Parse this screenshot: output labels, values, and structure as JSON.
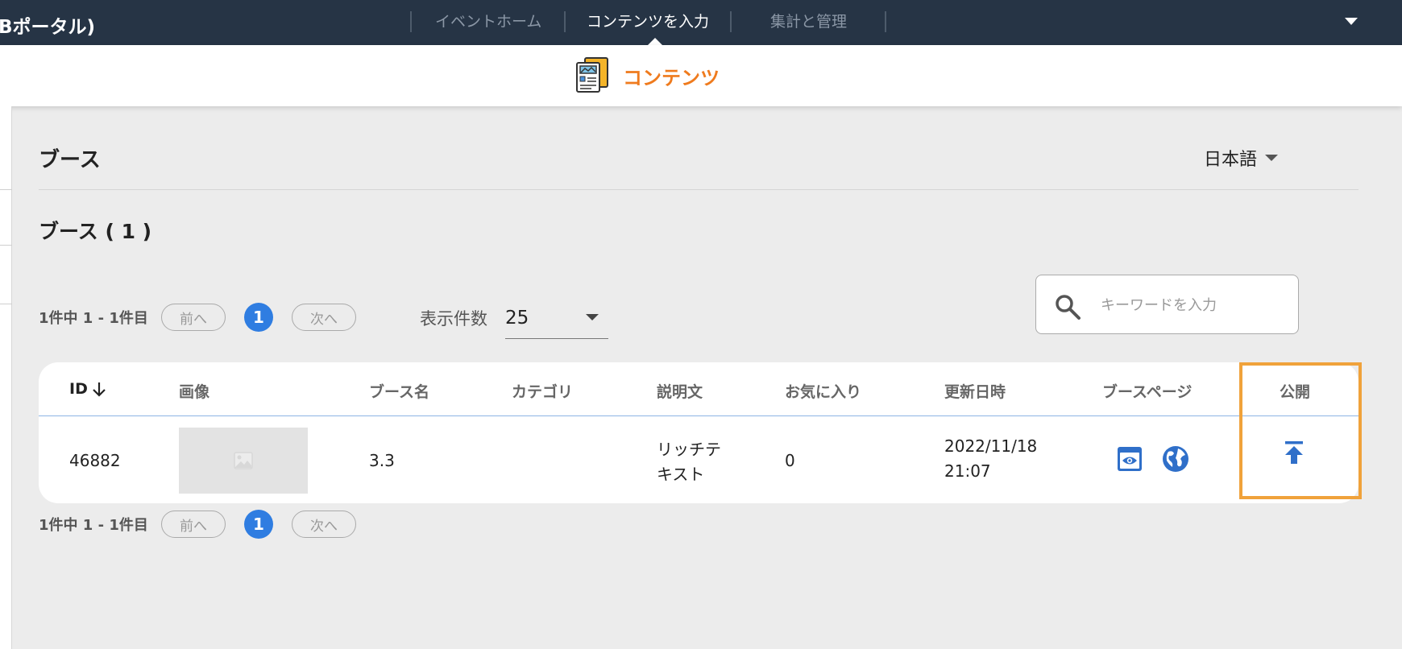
{
  "topnav": {
    "app_title": "Bポータル)",
    "tabs": [
      {
        "label": "イベントホーム",
        "active": false
      },
      {
        "label": "コンテンツを入力",
        "active": true
      },
      {
        "label": "集計と管理",
        "active": false
      }
    ]
  },
  "subheader": {
    "title": "コンテンツ",
    "icon": "content-document-icon"
  },
  "page": {
    "heading": "ブース",
    "language": "日本語",
    "section_title": "ブース ( 1 )"
  },
  "pager_top": {
    "count_text": "1件中 1 - 1件目",
    "prev": "前へ",
    "page": "1",
    "next": "次へ"
  },
  "pager_bottom": {
    "count_text": "1件中 1 - 1件目",
    "prev": "前へ",
    "page": "1",
    "next": "次へ"
  },
  "perpage": {
    "label": "表示件数",
    "value": "25"
  },
  "search": {
    "placeholder": "キーワードを入力"
  },
  "table": {
    "headers": {
      "id": "ID",
      "image": "画像",
      "name": "ブース名",
      "category": "カテゴリ",
      "description": "説明文",
      "favorites": "お気に入り",
      "updated": "更新日時",
      "booth_page": "ブースページ",
      "publish": "公開"
    },
    "rows": [
      {
        "id": "46882",
        "name": "3.3",
        "category": "",
        "description_line1": "リッチテ",
        "description_line2": "キスト",
        "favorites": "0",
        "updated_date": "2022/11/18",
        "updated_time": "21:07"
      }
    ]
  },
  "colors": {
    "nav_bg": "#263445",
    "accent_orange": "#ef7b1e",
    "primary_blue": "#2f7de1",
    "highlight": "#f0a23b"
  }
}
